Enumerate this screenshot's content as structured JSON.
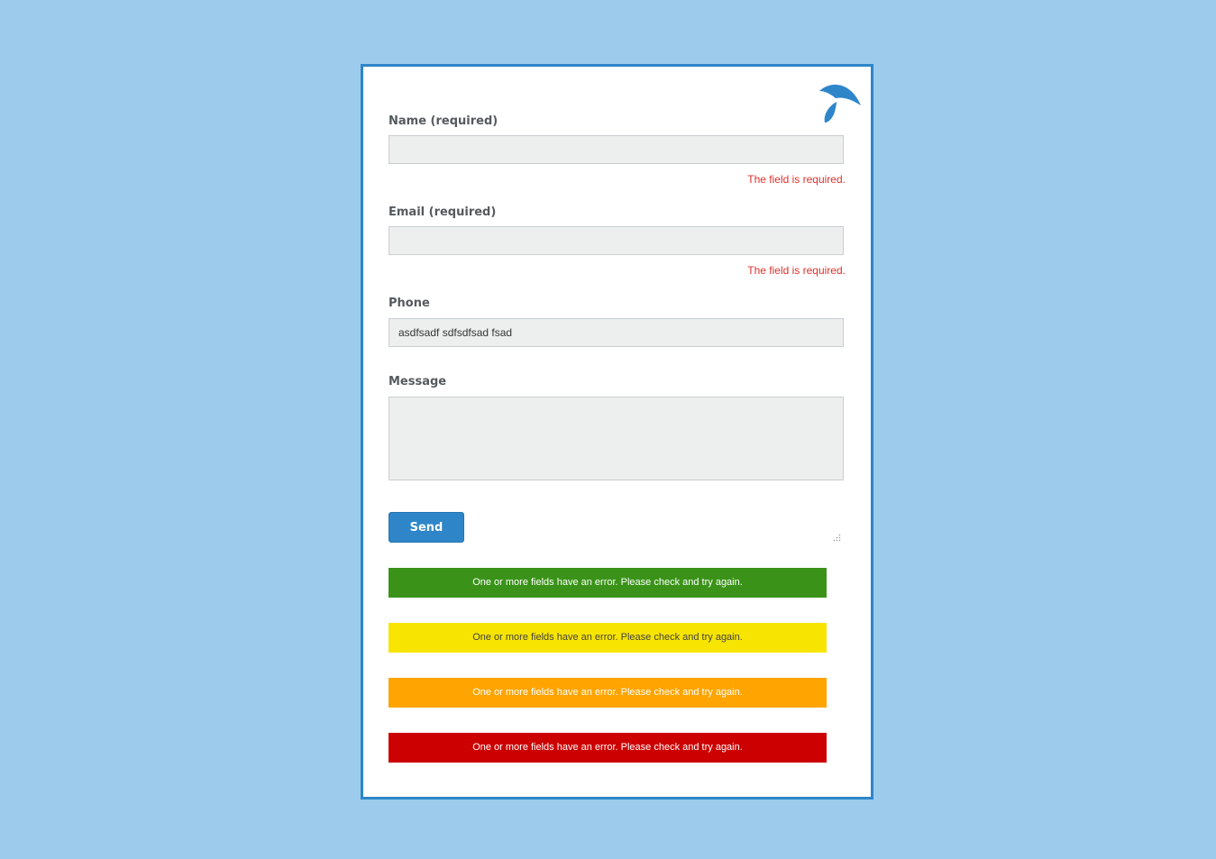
{
  "logo": {
    "icon": "bird-wing-logo-icon",
    "color": "#2e86c9"
  },
  "form": {
    "fields": [
      {
        "label": "Name (required)",
        "value": "",
        "error": "The field is required."
      },
      {
        "label": "Email (required)",
        "value": "",
        "error": "The field is required."
      },
      {
        "label": "Phone",
        "value": "asdfsadf sdfsdfsad fsad"
      },
      {
        "label": "Message",
        "value": ""
      }
    ],
    "send_label": "Send"
  },
  "messages": [
    {
      "text": "One or more fields have an error. Please check and try again.",
      "bg": "#3a9318",
      "fg": "#ffffff"
    },
    {
      "text": "One or more fields have an error. Please check and try again.",
      "bg": "#f7e400",
      "fg": "#444444"
    },
    {
      "text": "One or more fields have an error. Please check and try again.",
      "bg": "#ffa400",
      "fg": "#ffffff"
    },
    {
      "text": "One or more fields have an error. Please check and try again.",
      "bg": "#cc0000",
      "fg": "#ffffff"
    }
  ],
  "colors": {
    "background": "#9ccbeb",
    "accent": "#2e86c9",
    "error_text": "#e0312c"
  }
}
